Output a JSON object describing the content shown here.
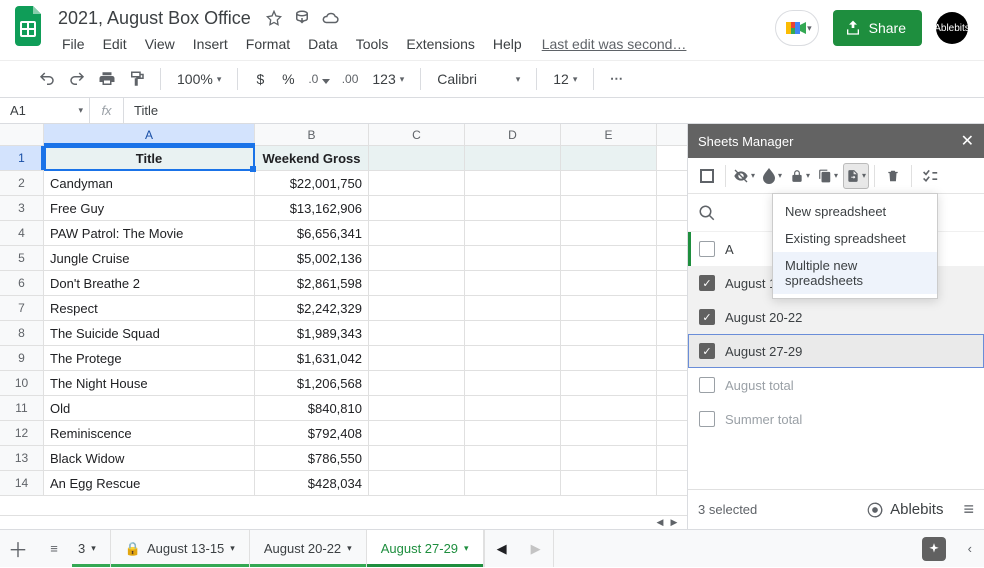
{
  "header": {
    "doc_title": "2021, August Box Office",
    "menus": [
      "File",
      "Edit",
      "View",
      "Insert",
      "Format",
      "Data",
      "Tools",
      "Extensions",
      "Help"
    ],
    "last_edit": "Last edit was second…",
    "share_label": "Share",
    "avatar_label": "Ablebits"
  },
  "toolbar": {
    "zoom": "100%",
    "currency": "$",
    "percent": "%",
    "dec_dec": ".0",
    "inc_dec": ".00",
    "num_format": "123",
    "font": "Calibri",
    "font_size": "12",
    "more": "…"
  },
  "name_box": "A1",
  "formula": "Title",
  "columns": [
    "A",
    "B",
    "C",
    "D",
    "E"
  ],
  "chart_data": {
    "type": "table",
    "columns": [
      "Title",
      "Weekend Gross"
    ],
    "rows": [
      [
        "Candyman",
        "$22,001,750"
      ],
      [
        "Free Guy",
        "$13,162,906"
      ],
      [
        "PAW Patrol: The Movie",
        "$6,656,341"
      ],
      [
        "Jungle Cruise",
        "$5,002,136"
      ],
      [
        "Don't Breathe 2",
        "$2,861,598"
      ],
      [
        "Respect",
        "$2,242,329"
      ],
      [
        "The Suicide Squad",
        "$1,989,343"
      ],
      [
        "The Protege",
        "$1,631,042"
      ],
      [
        "The Night House",
        "$1,206,568"
      ],
      [
        "Old",
        "$840,810"
      ],
      [
        "Reminiscence",
        "$792,408"
      ],
      [
        "Black Widow",
        "$786,550"
      ],
      [
        "An Egg Rescue",
        "$428,034"
      ]
    ]
  },
  "panel": {
    "title": "Sheets Manager",
    "dropdown": {
      "items": [
        "New spreadsheet",
        "Existing spreadsheet",
        "Multiple new spreadsheets"
      ],
      "hover_index": 2
    },
    "search_placeholder": "",
    "sheets": [
      {
        "name": "A",
        "checked": false,
        "locked": false,
        "truncated": true
      },
      {
        "name": "August 13-15",
        "checked": true,
        "locked": true
      },
      {
        "name": "August 20-22",
        "checked": true,
        "locked": false
      },
      {
        "name": "August 27-29",
        "checked": true,
        "locked": false,
        "current": true
      },
      {
        "name": "August total",
        "checked": false,
        "dim": true
      },
      {
        "name": "Summer total",
        "checked": false,
        "dim": true
      }
    ],
    "footer_status": "3 selected",
    "brand": "Ablebits"
  },
  "tabs": {
    "items": [
      {
        "label": "3",
        "partial": true
      },
      {
        "label": "August 13-15",
        "locked": true
      },
      {
        "label": "August 20-22"
      },
      {
        "label": "August 27-29",
        "active": true
      }
    ]
  }
}
